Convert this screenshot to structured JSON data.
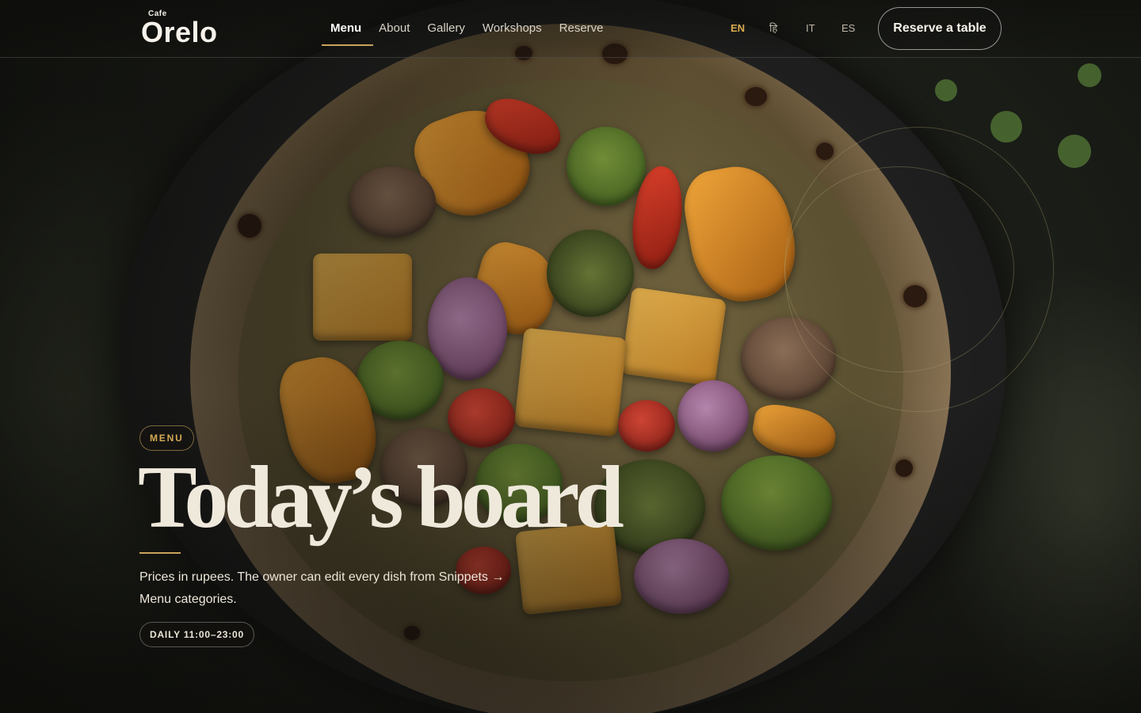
{
  "brand": {
    "small": "Cafe",
    "name": "Orelo"
  },
  "nav": {
    "items": [
      {
        "label": "Menu",
        "active": true
      },
      {
        "label": "About",
        "active": false
      },
      {
        "label": "Gallery",
        "active": false
      },
      {
        "label": "Workshops",
        "active": false
      },
      {
        "label": "Reserve",
        "active": false
      }
    ]
  },
  "languages": [
    {
      "code": "EN",
      "active": true
    },
    {
      "code": "हि",
      "active": false
    },
    {
      "code": "IT",
      "active": false
    },
    {
      "code": "ES",
      "active": false
    }
  ],
  "cta": {
    "reserve_label": "Reserve a table"
  },
  "hero": {
    "eyebrow": "MENU",
    "title": "Today’s board",
    "description": "Prices in rupees. The owner can edit every dish from Snippets → Menu categories.",
    "hours": "DAILY 11:00–23:00"
  },
  "colors": {
    "accent_gold": "#c9a35a",
    "language_active": "#d8aa4e",
    "text_cream": "#efe9dc"
  },
  "icons": [
    "hero-pizza-image"
  ]
}
